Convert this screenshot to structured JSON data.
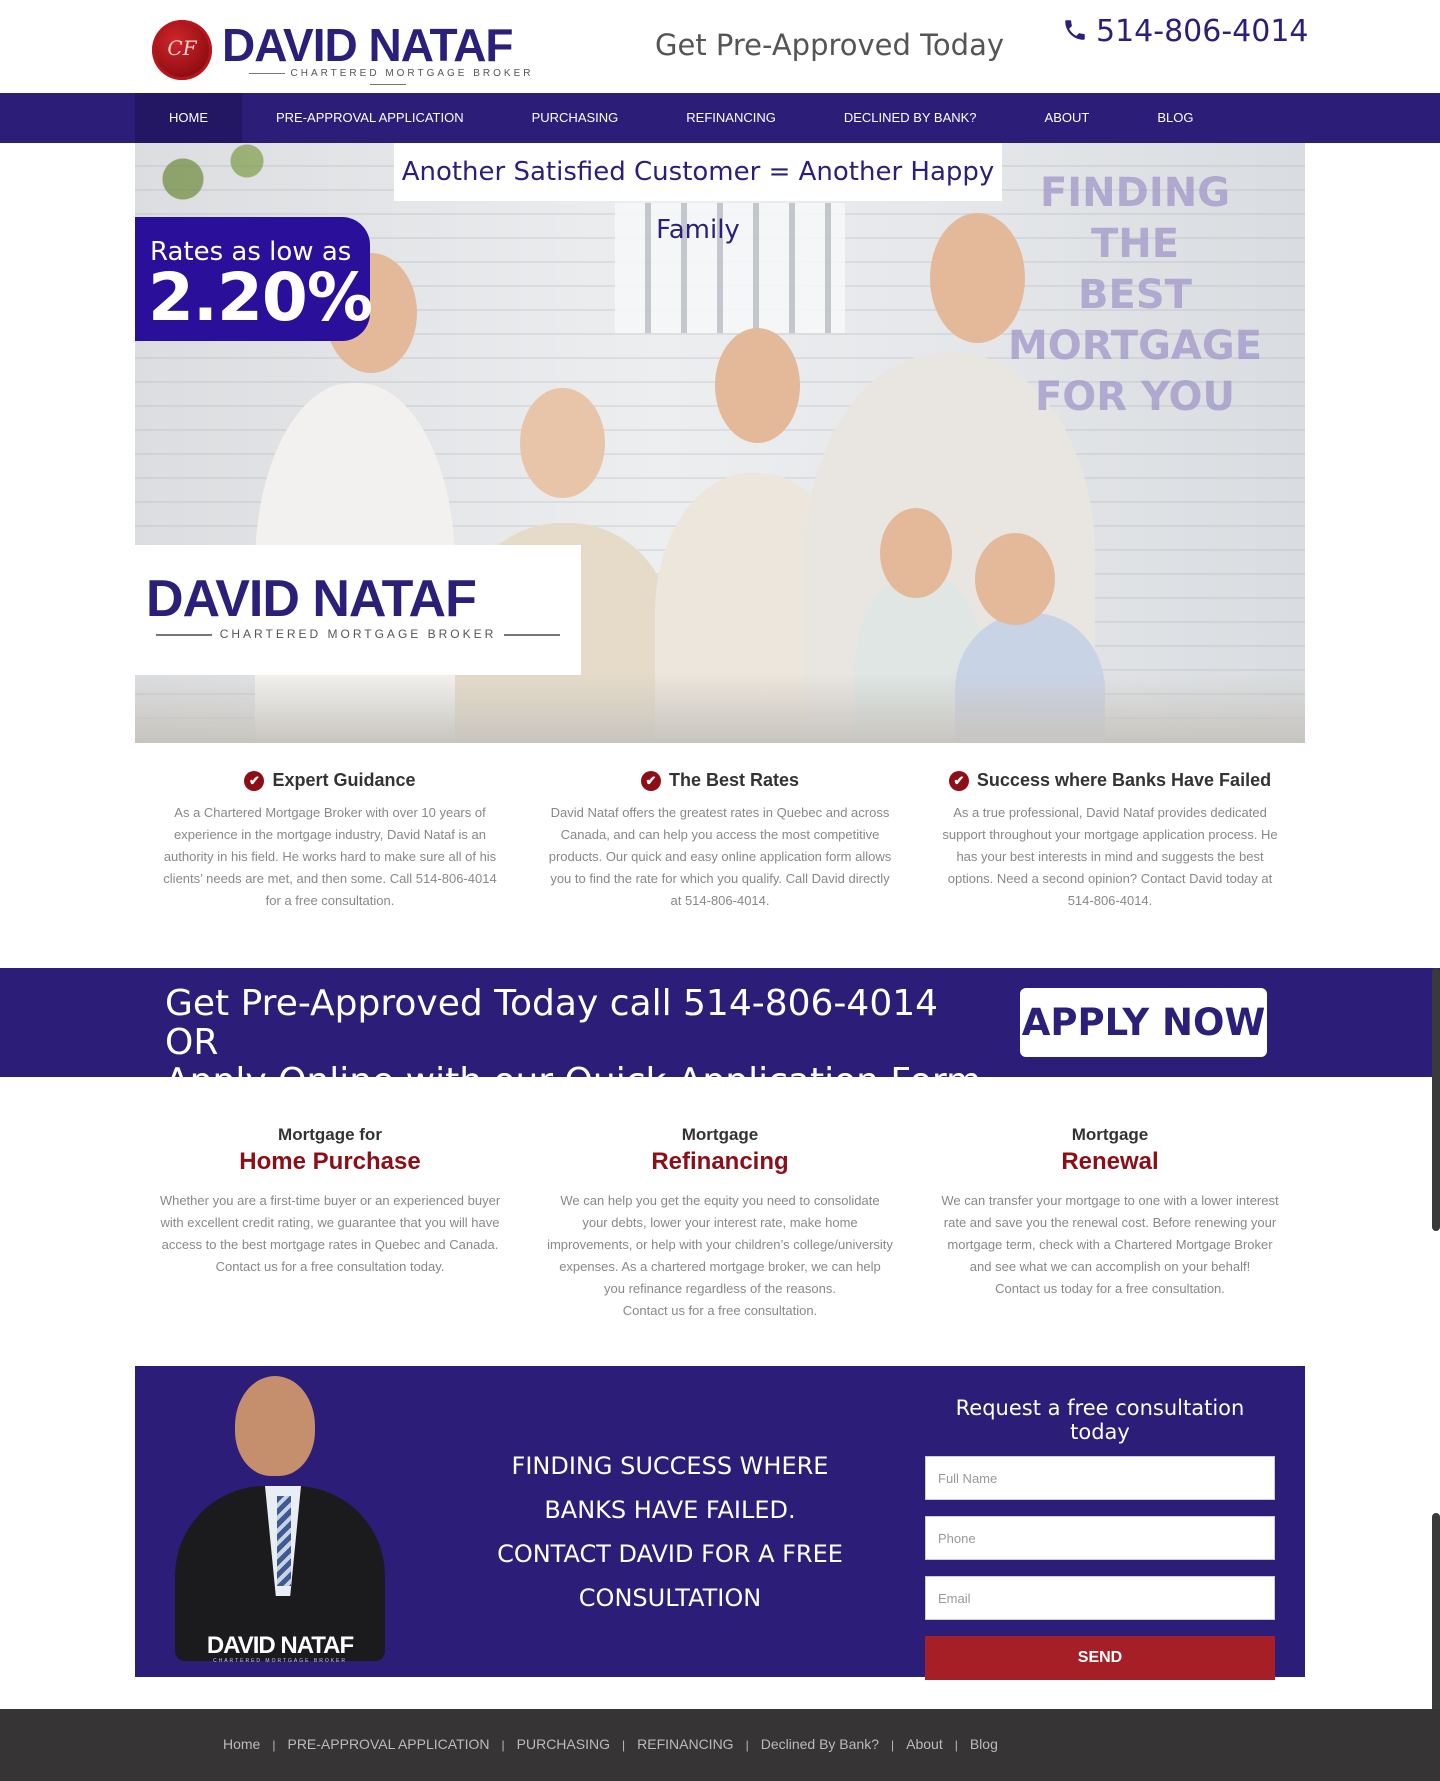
{
  "header": {
    "logo_monogram": "CF",
    "logo_name": "DAVID NATAF",
    "logo_sub": "CHARTERED MORTGAGE BROKER",
    "tagline": "Get Pre-Approved Today",
    "phone": "514-806-4014"
  },
  "nav": {
    "items": [
      {
        "label": "HOME"
      },
      {
        "label": "PRE-APPROVAL APPLICATION"
      },
      {
        "label": "PURCHASING"
      },
      {
        "label": "REFINANCING"
      },
      {
        "label": "DECLINED BY BANK?"
      },
      {
        "label": "ABOUT"
      },
      {
        "label": "BLOG"
      }
    ],
    "active": "HOME"
  },
  "hero": {
    "caption": "Another Satisfied Customer = Another Happy Family",
    "rate_label": "Rates as low as",
    "rate_value": "2.20%",
    "overlay_lines": [
      "FINDING THE",
      "BEST",
      "MORTGAGE",
      "FOR YOU"
    ],
    "logo_name": "DAVID NATAF",
    "logo_sub": "CHARTERED MORTGAGE BROKER"
  },
  "features": [
    {
      "title": "Expert Guidance",
      "text": "As a Chartered Mortgage Broker with over 10 years of experience in the mortgage industry, David Nataf is an authority in his field. He works hard to make sure all of his clients’ needs are met, and then some. Call 514-806-4014 for a free consultation."
    },
    {
      "title": "The Best Rates",
      "text": "David Nataf offers the greatest rates in Quebec and across Canada, and can help you access the most competitive products. Our quick and easy online application form allows you to find the rate for which you qualify. Call David directly at 514-806-4014."
    },
    {
      "title": "Success where Banks Have Failed",
      "text": "As a true professional, David Nataf provides dedicated support throughout your mortgage application process. He has your best interests in mind and suggests the best options. Need a second opinion? Contact David today at 514-806-4014."
    }
  ],
  "cta": {
    "line1": "Get Pre-Approved Today call 514-806-4014 OR",
    "line2": "Apply Online with our Quick Application Form",
    "button": "APPLY NOW"
  },
  "services": [
    {
      "pre": "Mortgage for",
      "title": "Home Purchase",
      "text": "Whether you are a first-time buyer or an experienced buyer with excellent credit rating, we guarantee that you will have access to the best mortgage rates in Quebec and Canada. Contact us for a free consultation today."
    },
    {
      "pre": "Mortgage",
      "title": "Refinancing",
      "text": "We can help you get the equity you need to consolidate your debts, lower your interest rate, make home improvements, or help with your children’s college/university expenses. As a chartered mortgage broker, we can help you refinance regardless of the reasons.",
      "text2": "Contact us for a free consultation."
    },
    {
      "pre": "Mortgage",
      "title": "Renewal",
      "text": "We can transfer your mortgage to one with a lower interest rate and save you the renewal cost. Before renewing your mortgage term, check with a Chartered Mortgage Broker and see what we can accomplish on your behalf!",
      "text2": "Contact us today for a free consultation."
    }
  ],
  "consult": {
    "photo_logo": "DAVID NATAF",
    "photo_logo_sub": "CHARTERED MORTGAGE BROKER",
    "message_lines": [
      "FINDING SUCCESS WHERE",
      "BANKS HAVE FAILED.",
      "CONTACT DAVID FOR A FREE",
      "CONSULTATION"
    ],
    "form_title": "Request a free consultation today",
    "name_placeholder": "Full Name",
    "phone_placeholder": "Phone",
    "email_placeholder": "Email",
    "send_label": "SEND"
  },
  "footer": {
    "items": [
      {
        "label": "Home"
      },
      {
        "label": "PRE-APPROVAL APPLICATION"
      },
      {
        "label": "PURCHASING"
      },
      {
        "label": "REFINANCING"
      },
      {
        "label": "Declined By Bank?"
      },
      {
        "label": "About"
      },
      {
        "label": "Blog"
      }
    ]
  },
  "colors": {
    "brand_purple": "#2c1d79",
    "accent_red": "#8d0e16",
    "send_red": "#a61f27",
    "footer_bg": "#363434"
  }
}
